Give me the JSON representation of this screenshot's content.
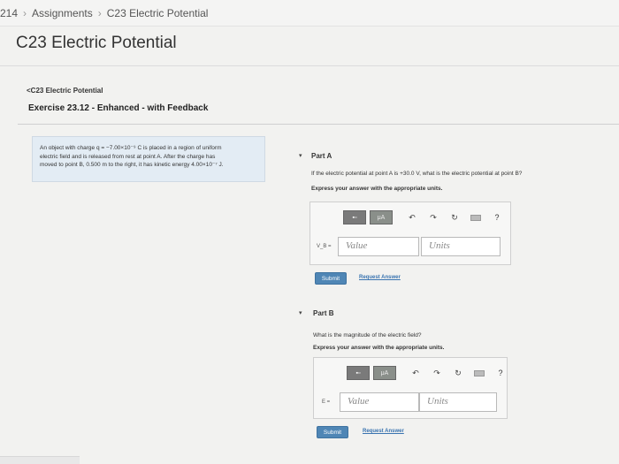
{
  "breadcrumb": {
    "course": "214",
    "sep1": "›",
    "assignments": "Assignments",
    "sep2": "›",
    "current": "C23 Electric Potential"
  },
  "page_title": "C23 Electric Potential",
  "back_link": "<C23 Electric Potential",
  "exercise_title": "Exercise 23.12 - Enhanced - with Feedback",
  "problem": {
    "line1": "An object with charge q = −7.00×10⁻⁹ C is placed in a region of uniform",
    "line2": "electric field and is released from rest at point A. After the charge has",
    "line3": "moved to point B, 0.500 m to the right, it has kinetic energy 4.00×10⁻⁷ J."
  },
  "part_a": {
    "toggle": "▾",
    "title": "Part A",
    "question": "If the electric potential at point A is +30.0 V, what is the electric potential at point B?",
    "instruction": "Express your answer with the appropriate units.",
    "var_label": "V_B =",
    "value_placeholder": "Value",
    "units_placeholder": "Units",
    "submit": "Submit",
    "request_answer": "Request Answer"
  },
  "part_b": {
    "toggle": "▾",
    "title": "Part B",
    "question": "What is the magnitude of the electric field?",
    "instruction": "Express your answer with the appropriate units.",
    "var_label": "E =",
    "value_placeholder": "Value",
    "units_placeholder": "Units",
    "submit": "Submit",
    "request_answer": "Request Answer"
  },
  "toolbar": {
    "templates_icon": "▪▫",
    "mu_label": "μA",
    "undo_icon": "↶",
    "redo_icon": "↷",
    "reset_icon": "↻",
    "help_icon": "?"
  },
  "colors": {
    "submit_bg": "#4f86b5",
    "link": "#3a74b0",
    "problem_bg": "#e3ecf4"
  }
}
